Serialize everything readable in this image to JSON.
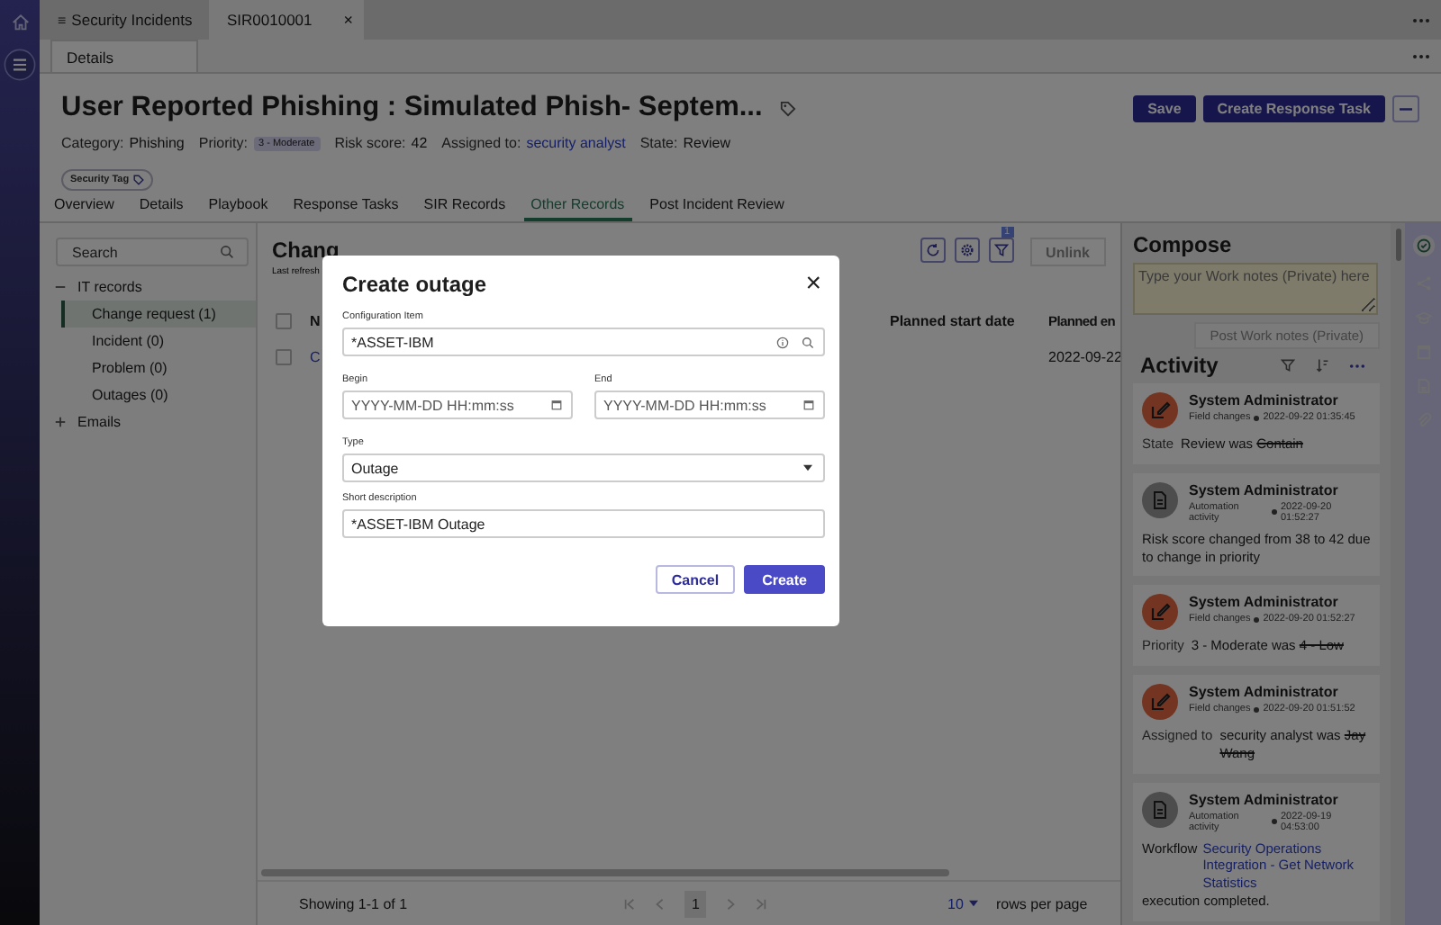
{
  "app_tabs": [
    {
      "label": "Security Incidents",
      "selected": false,
      "menu": "≡"
    },
    {
      "label": "SIR0010001",
      "selected": true,
      "close": "×"
    }
  ],
  "sub_tabs": [
    {
      "label": "Details",
      "selected": true
    }
  ],
  "record": {
    "title": "User Reported Phishing : Simulated Phish- Septem...",
    "meta": [
      {
        "label": "Category:",
        "value": "Phishing",
        "kind": "text"
      },
      {
        "label": "Priority:",
        "value": "3 - Moderate",
        "kind": "pill"
      },
      {
        "label": "Risk score:",
        "value": "42",
        "kind": "text"
      },
      {
        "label": "Assigned to:",
        "value": "security analyst",
        "kind": "link"
      },
      {
        "label": "State:",
        "value": "Review",
        "kind": "text"
      }
    ],
    "tag": "Security Tag"
  },
  "actions": [
    {
      "label": "Save"
    },
    {
      "label": "Create Response Task"
    }
  ],
  "tabs": [
    {
      "label": "Overview",
      "selected": false
    },
    {
      "label": "Details",
      "selected": false
    },
    {
      "label": "Playbook",
      "selected": false
    },
    {
      "label": "Response Tasks",
      "selected": false
    },
    {
      "label": "SIR Records",
      "selected": false
    },
    {
      "label": "Other Records",
      "selected": true
    },
    {
      "label": "Post Incident Review",
      "selected": false
    }
  ],
  "tree": {
    "search_placeholder": "Search",
    "groups": [
      {
        "label": "IT records",
        "expanded": true,
        "children": [
          {
            "label": "Change request (1)",
            "selected": true
          },
          {
            "label": "Incident (0)",
            "selected": false
          },
          {
            "label": "Problem (0)",
            "selected": false
          },
          {
            "label": "Outages (0)",
            "selected": false
          }
        ]
      },
      {
        "label": "Emails",
        "expanded": false
      }
    ]
  },
  "list": {
    "title": "Chang",
    "subtitle": "Last refresh",
    "filter_count": "1",
    "unlink": "Unlink",
    "unlink_disabled": true,
    "header_checked": false,
    "columns": [
      "N",
      "Planned start date",
      "Planned en"
    ],
    "rows": [
      {
        "checked": false,
        "number": "C",
        "date": "2022-09-22"
      }
    ]
  },
  "footer": {
    "showing": "Showing 1-1 of 1",
    "page": "1",
    "page_size": "10",
    "rows_per_page": "rows per page"
  },
  "compose": {
    "title": "Compose",
    "placeholder": "Type your Work notes (Private) here",
    "post": "Post Work notes (Private)",
    "post_disabled": true
  },
  "activity": {
    "title": "Activity",
    "entries": [
      {
        "kind": "field_change",
        "author": "System Administrator",
        "source": "Field changes",
        "time": "2022-09-22 01:35:45",
        "field": "State",
        "new": "Review was",
        "old": "Contain"
      },
      {
        "kind": "automation",
        "author": "System Administrator",
        "source": "Automation activity",
        "time": "2022-09-20 01:52:27",
        "text": "Risk score changed from 38 to 42 due to change in priority"
      },
      {
        "kind": "field_change",
        "author": "System Administrator",
        "source": "Field changes",
        "time": "2022-09-20 01:52:27",
        "field": "Priority",
        "new": "3 - Moderate was",
        "old": "4 - Low"
      },
      {
        "kind": "field_change",
        "author": "System Administrator",
        "source": "Field changes",
        "time": "2022-09-20 01:51:52",
        "field": "Assigned to",
        "new": "security analyst was",
        "old": "Jay Wang"
      },
      {
        "kind": "automation",
        "author": "System Administrator",
        "source": "Automation activity",
        "time": "2022-09-19 04:53:00",
        "text": "Workflow",
        "link": "Security Operations Integration - Get Network Statistics",
        "after": "execution completed."
      }
    ]
  },
  "modal": {
    "title": "Create outage",
    "close": "×",
    "fields": [
      {
        "label": "Configuration Item",
        "value": "*ASSET-IBM",
        "kind": "reference"
      },
      {
        "label": "Begin",
        "placeholder": "YYYY-MM-DD HH:mm:ss",
        "kind": "date"
      },
      {
        "label": "End",
        "placeholder": "YYYY-MM-DD HH:mm:ss",
        "kind": "date"
      },
      {
        "label": "Type",
        "value": "Outage",
        "kind": "select"
      },
      {
        "label": "Short description",
        "value": "*ASSET-IBM Outage",
        "kind": "text"
      }
    ],
    "buttons": [
      {
        "label": "Cancel",
        "primary": false
      },
      {
        "label": "Create",
        "primary": true
      }
    ]
  }
}
